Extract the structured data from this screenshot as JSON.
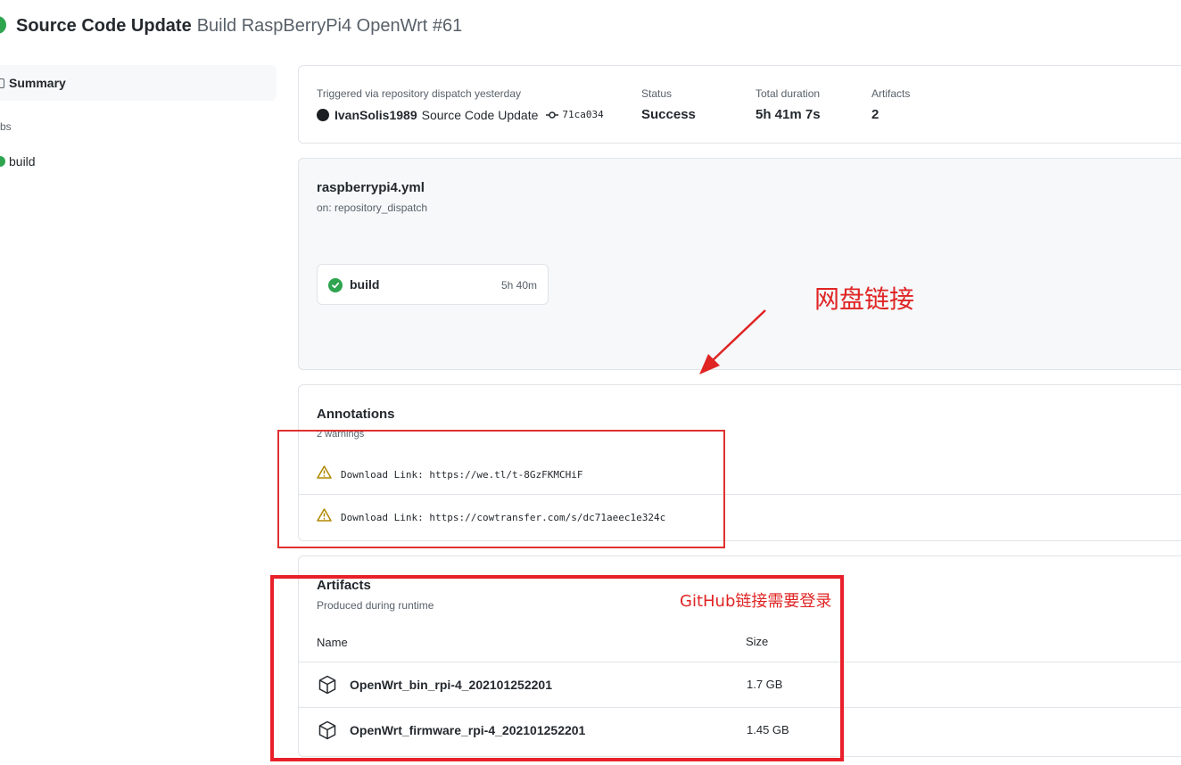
{
  "header": {
    "title": "Source Code Update",
    "subtitle": "Build RaspBerryPi4 OpenWrt #61"
  },
  "sidebar": {
    "summary_label": "Summary",
    "jobs_label": "bs",
    "build_label": "build"
  },
  "run": {
    "trigger_text": "Triggered via repository dispatch yesterday",
    "actor": "IvanSolis1989",
    "commit_message": "Source Code Update",
    "commit_sha": "71ca034",
    "status_label": "Status",
    "status_value": "Success",
    "duration_label": "Total duration",
    "duration_value": "5h 41m 7s",
    "artifacts_label": "Artifacts",
    "artifacts_value": "2"
  },
  "workflow": {
    "file": "raspberrypi4.yml",
    "trigger": "on: repository_dispatch",
    "job": {
      "name": "build",
      "duration": "5h 40m"
    }
  },
  "annotations": {
    "title": "Annotations",
    "count": "2 warnings",
    "items": [
      {
        "text": "Download Link: https://we.tl/t-8GzFKMCHiF"
      },
      {
        "text": "Download Link: https://cowtransfer.com/s/dc71aeec1e324c"
      }
    ]
  },
  "artifacts": {
    "title": "Artifacts",
    "subtitle": "Produced during runtime",
    "col_name": "Name",
    "col_size": "Size",
    "items": [
      {
        "name": "OpenWrt_bin_rpi-4_202101252201",
        "size": "1.7 GB"
      },
      {
        "name": "OpenWrt_firmware_rpi-4_202101252201",
        "size": "1.45 GB"
      }
    ]
  },
  "overlay": {
    "netdisk_label": "网盘链接",
    "github_label": "GitHub链接需要登录",
    "color": "#e02424"
  },
  "colors": {
    "success": "#2ea44f",
    "warning": "#b08800",
    "border": "#e1e4e8",
    "muted": "#586069"
  }
}
